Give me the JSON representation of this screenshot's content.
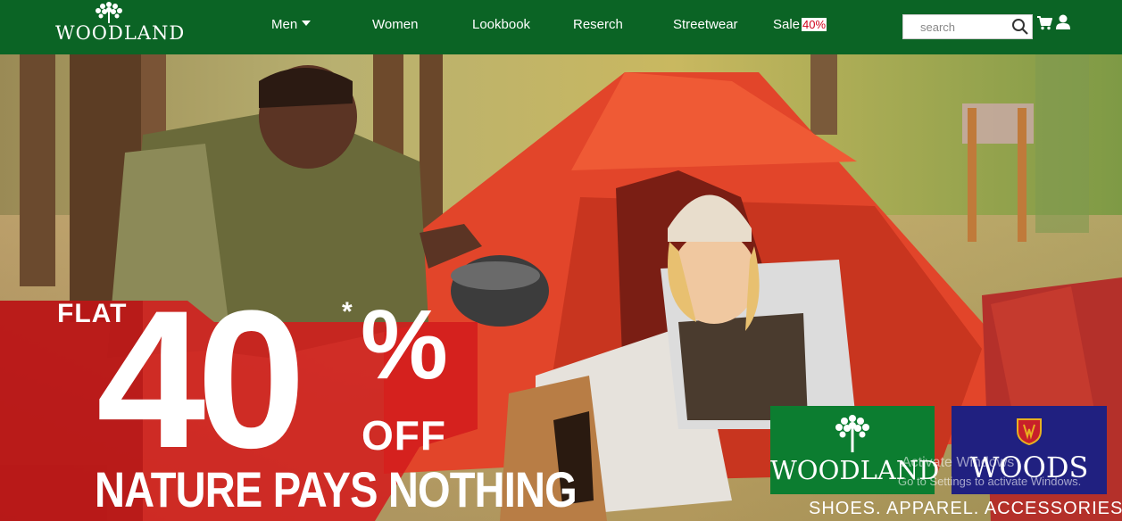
{
  "brand": {
    "name": "WOODLAND"
  },
  "nav": {
    "items": [
      {
        "label": "Men",
        "has_dropdown": true
      },
      {
        "label": "Women"
      },
      {
        "label": "Lookbook"
      },
      {
        "label": "Reserch"
      },
      {
        "label": "Streetwear"
      },
      {
        "label": "Sale",
        "badge": "40%"
      }
    ]
  },
  "search": {
    "placeholder": "search"
  },
  "icons": {
    "search": "search-icon",
    "cart": "cart-icon",
    "user": "user-icon"
  },
  "colors": {
    "nav_bg": "#0b6425",
    "sale_badge": "#d0021b",
    "brand_green": "#0c7d30",
    "brand_blue": "#202080"
  },
  "banner": {
    "flat": "FLAT",
    "number": "40",
    "percent": "%",
    "asterisk": "*",
    "off": "OFF",
    "tagline": "NATURE PAYS NOTHING",
    "brand_left": "WOODLAND",
    "brand_right": "WOODS",
    "categories": "SHOES. APPAREL. ACCESSORIES."
  },
  "watermark": {
    "line1": "Activate Windows",
    "line2": "Go to Settings to activate Windows."
  }
}
